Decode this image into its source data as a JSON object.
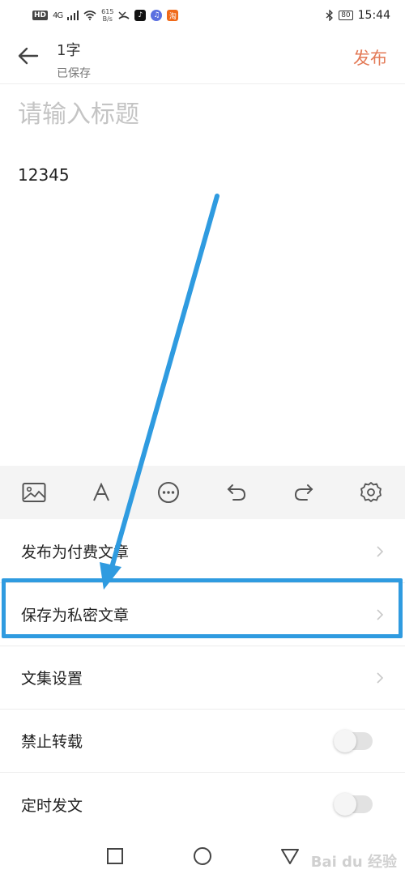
{
  "status_bar": {
    "hd": "HD",
    "network": "4G",
    "speed_value": "615",
    "speed_unit": "B/s",
    "taobao_glyph": "淘",
    "battery": "80",
    "time": "15:44"
  },
  "header": {
    "word_count": "1字",
    "save_status": "已保存",
    "publish_label": "发布"
  },
  "editor": {
    "title_placeholder": "请输入标题",
    "title_value": "",
    "body_text": "12345"
  },
  "toolbar": {
    "icons": [
      "image-icon",
      "text-format-icon",
      "more-icon",
      "undo-icon",
      "redo-icon",
      "settings-icon"
    ]
  },
  "settings": {
    "paid_article": "发布为付费文章",
    "private_article": "保存为私密文章",
    "collection_settings": "文集设置",
    "forbid_repost": {
      "label": "禁止转载",
      "enabled": false
    },
    "scheduled_post": {
      "label": "定时发文",
      "enabled": false
    }
  },
  "annotation": {
    "color": "#2f9be0"
  },
  "colors": {
    "accent": "#e37a57",
    "toolbar_bg": "#f4f4f4",
    "annotation": "#2f9be0"
  },
  "watermark": "Bai du 经验"
}
